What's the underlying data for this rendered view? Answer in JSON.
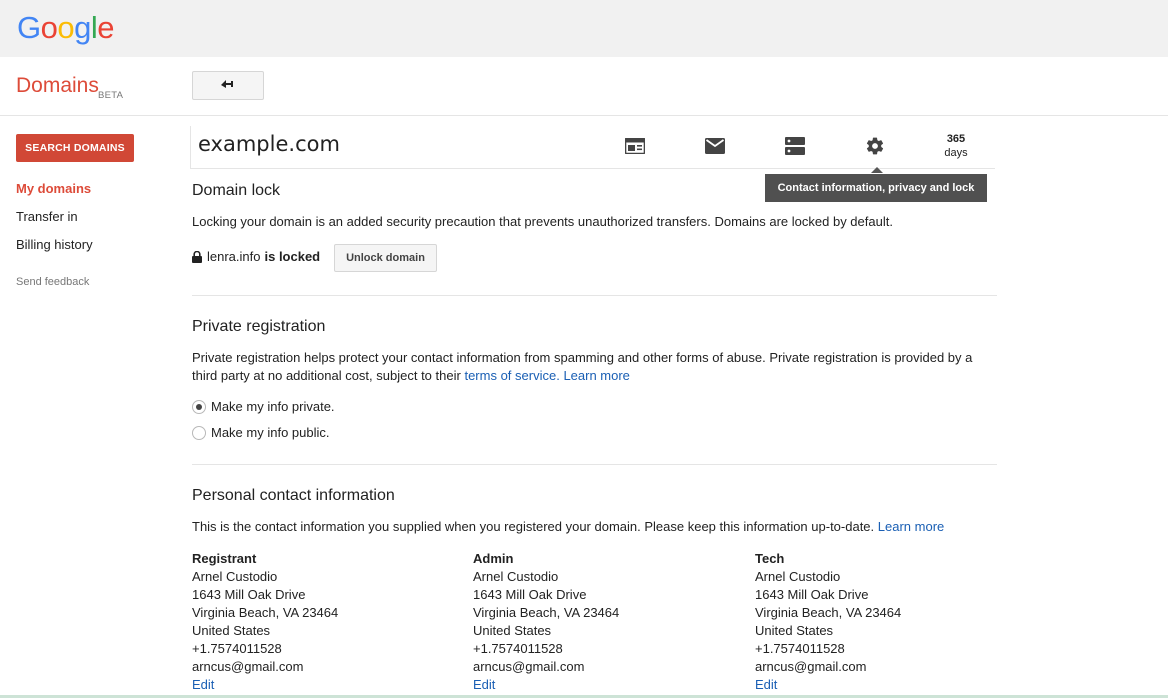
{
  "brand": {
    "logo_letters": [
      {
        "ch": "G",
        "color": "#4285F4"
      },
      {
        "ch": "o",
        "color": "#EA4335"
      },
      {
        "ch": "o",
        "color": "#FBBC05"
      },
      {
        "ch": "g",
        "color": "#4285F4"
      },
      {
        "ch": "l",
        "color": "#34A853"
      },
      {
        "ch": "e",
        "color": "#EA4335"
      }
    ],
    "product": "Domains",
    "badge": "BETA"
  },
  "header": {
    "back_icon": "back-arrow-icon"
  },
  "sidebar": {
    "search_button": "SEARCH DOMAINS",
    "items": [
      {
        "label": "My domains",
        "active": true
      },
      {
        "label": "Transfer in",
        "active": false
      },
      {
        "label": "Billing history",
        "active": false
      }
    ],
    "feedback": "Send feedback"
  },
  "domain": {
    "name": "example.com",
    "icons": [
      "website-icon",
      "email-icon",
      "dns-icon",
      "settings-icon"
    ],
    "days_number": "365",
    "days_label": "days",
    "tooltip": "Contact information, privacy and lock"
  },
  "domain_lock": {
    "title": "Domain lock",
    "description": "Locking your domain is an added security precaution that prevents unauthorized transfers. Domains are locked by default.",
    "locked_domain": "lenra.info",
    "locked_text": "is locked",
    "unlock_button": "Unlock domain"
  },
  "private_registration": {
    "title": "Private registration",
    "description": "Private registration helps protect your contact information from spamming and other forms of abuse. Private registration is provided by a third party at no additional cost, subject to their",
    "terms_link": "terms of service.",
    "learn_more": "Learn more",
    "options": [
      {
        "label": "Make my info private.",
        "checked": true
      },
      {
        "label": "Make my info public.",
        "checked": false
      }
    ]
  },
  "personal_contact": {
    "title": "Personal contact information",
    "description": "This is the contact information you supplied when you registered your domain. Please keep this information up-to-date.",
    "learn_more": "Learn more",
    "contacts": [
      {
        "role": "Registrant",
        "name": "Arnel Custodio",
        "street": "1643 Mill Oak Drive",
        "city": "Virginia Beach, VA 23464",
        "country": "United States",
        "phone": "+1.7574011528",
        "email": "arncus@gmail.com",
        "edit": "Edit"
      },
      {
        "role": "Admin",
        "name": "Arnel Custodio",
        "street": "1643 Mill Oak Drive",
        "city": "Virginia Beach, VA 23464",
        "country": "United States",
        "phone": "+1.7574011528",
        "email": "arncus@gmail.com",
        "edit": "Edit"
      },
      {
        "role": "Tech",
        "name": "Arnel Custodio",
        "street": "1643 Mill Oak Drive",
        "city": "Virginia Beach, VA 23464",
        "country": "United States",
        "phone": "+1.7574011528",
        "email": "arncus@gmail.com",
        "edit": "Edit"
      }
    ]
  }
}
